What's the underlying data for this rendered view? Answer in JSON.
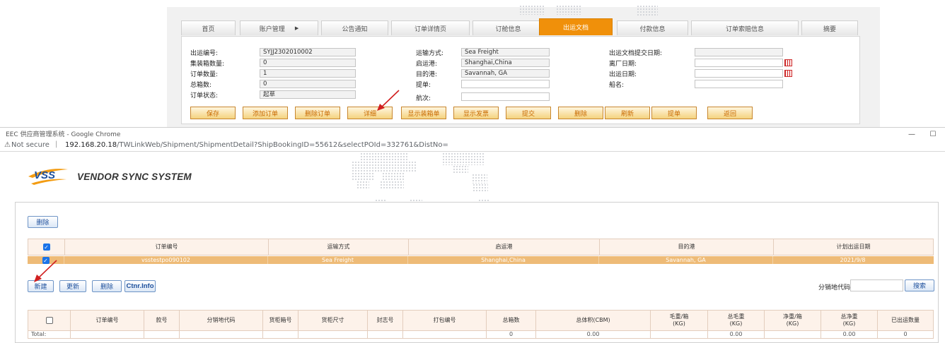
{
  "background_window": {
    "tabs": [
      {
        "label": "首页",
        "active": false
      },
      {
        "label": "账户管理",
        "active": false,
        "has_arrow": true
      },
      {
        "label": "公告通知",
        "active": false
      },
      {
        "label": "订单详情页",
        "active": false
      },
      {
        "label": "订舱信息",
        "active": false
      },
      {
        "label": "出运文档",
        "active": true
      },
      {
        "label": "付款信息",
        "active": false
      },
      {
        "label": "订单索赔信息",
        "active": false
      },
      {
        "label": "摘要",
        "active": false
      }
    ],
    "form": {
      "left": [
        {
          "label": "出运编号:",
          "value": "SYJJ2302010002"
        },
        {
          "label": "集装箱数量:",
          "value": "0"
        },
        {
          "label": "订单数量:",
          "value": "1"
        },
        {
          "label": "总箱数:",
          "value": "0"
        },
        {
          "label": "订单状态:",
          "value": "起草"
        }
      ],
      "middle": [
        {
          "label": "运输方式:",
          "value": "Sea Freight"
        },
        {
          "label": "启运港:",
          "value": "Shanghai,China"
        },
        {
          "label": "目的港:",
          "value": "Savannah, GA"
        },
        {
          "label": "提单:",
          "value": ""
        },
        {
          "label": "航次:",
          "value": ""
        }
      ],
      "right": [
        {
          "label": "出运文档提交日期:",
          "value": ""
        },
        {
          "label": "离厂日期:",
          "value": ""
        },
        {
          "label": "出运日期:",
          "value": ""
        },
        {
          "label": "船名:",
          "value": ""
        }
      ]
    },
    "buttons": [
      "保存",
      "添加订单",
      "删除订单",
      "详细",
      "显示装箱单",
      "显示发票",
      "提交",
      "删除",
      "刷新",
      "提单",
      "返回"
    ]
  },
  "chrome": {
    "window_title": "EEC 供应商管理系统 - Google Chrome",
    "minimize": "—",
    "maximize": "☐",
    "lock_icon": "⚠",
    "secure_label": "Not secure",
    "separator": "|",
    "url_host": "192.168.20.18",
    "url_path": "/TWLinkWeb/Shipment/ShipmentDetail?ShipBookingID=55612&selectPOId=332761&DistNo="
  },
  "header": {
    "logo_text": "VENDOR SYNC SYSTEM",
    "logo_mark": "VSS"
  },
  "main": {
    "delete_button": "删除",
    "order_grid": {
      "columns": [
        "订单编号",
        "运输方式",
        "启运港",
        "目的港",
        "计划出运日期"
      ],
      "rows": [
        {
          "checked": true,
          "order_no": "vsstestpo090102",
          "transport": "Sea Freight",
          "origin": "Shanghai,China",
          "destination": "Savannah, GA",
          "planned_date": "2021/9/8"
        }
      ],
      "header_checked": true
    },
    "actions": [
      "新建",
      "更新",
      "删除",
      "Ctnr.Info"
    ],
    "search": {
      "label": "分销地代码:",
      "value": "",
      "button": "搜索"
    },
    "box_grid": {
      "columns": [
        "订单编号",
        "款号",
        "分销地代码",
        "货柜箱号",
        "货柜尺寸",
        "封志号",
        "打包编号",
        "总箱数",
        "总体积(CBM)",
        "毛重/箱\n(KG)",
        "总毛重\n(KG)",
        "净重/箱\n(KG)",
        "总净重\n(KG)",
        "已出运数量"
      ],
      "total_row": {
        "label": "Total:",
        "total_cartons": "0",
        "total_cbm": "0.00",
        "total_gross": "0.00",
        "total_net": "0.00",
        "shipped_qty": "0"
      }
    }
  },
  "colors": {
    "active_tab": "#f0900a",
    "selected_row": "#eebb77",
    "grid_header": "#fdf2ea",
    "button_text": "#1d4f9c",
    "arrow": "#d11f1f"
  }
}
